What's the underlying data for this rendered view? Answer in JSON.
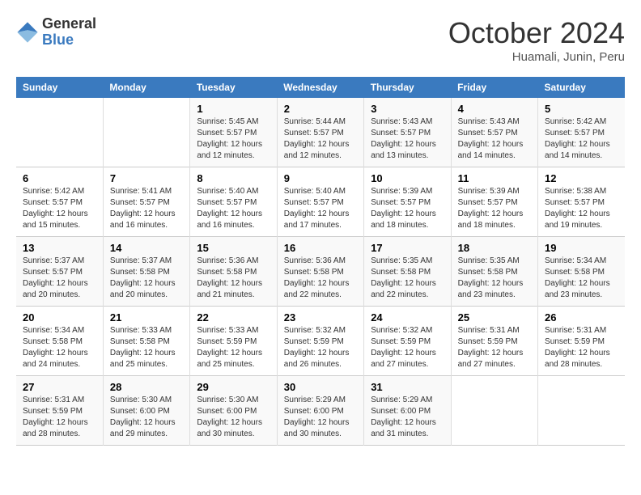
{
  "header": {
    "logo_line1": "General",
    "logo_line2": "Blue",
    "month": "October 2024",
    "location": "Huamali, Junin, Peru"
  },
  "weekdays": [
    "Sunday",
    "Monday",
    "Tuesday",
    "Wednesday",
    "Thursday",
    "Friday",
    "Saturday"
  ],
  "weeks": [
    [
      {
        "day": "",
        "info": ""
      },
      {
        "day": "",
        "info": ""
      },
      {
        "day": "1",
        "info": "Sunrise: 5:45 AM\nSunset: 5:57 PM\nDaylight: 12 hours and 12 minutes."
      },
      {
        "day": "2",
        "info": "Sunrise: 5:44 AM\nSunset: 5:57 PM\nDaylight: 12 hours and 12 minutes."
      },
      {
        "day": "3",
        "info": "Sunrise: 5:43 AM\nSunset: 5:57 PM\nDaylight: 12 hours and 13 minutes."
      },
      {
        "day": "4",
        "info": "Sunrise: 5:43 AM\nSunset: 5:57 PM\nDaylight: 12 hours and 14 minutes."
      },
      {
        "day": "5",
        "info": "Sunrise: 5:42 AM\nSunset: 5:57 PM\nDaylight: 12 hours and 14 minutes."
      }
    ],
    [
      {
        "day": "6",
        "info": "Sunrise: 5:42 AM\nSunset: 5:57 PM\nDaylight: 12 hours and 15 minutes."
      },
      {
        "day": "7",
        "info": "Sunrise: 5:41 AM\nSunset: 5:57 PM\nDaylight: 12 hours and 16 minutes."
      },
      {
        "day": "8",
        "info": "Sunrise: 5:40 AM\nSunset: 5:57 PM\nDaylight: 12 hours and 16 minutes."
      },
      {
        "day": "9",
        "info": "Sunrise: 5:40 AM\nSunset: 5:57 PM\nDaylight: 12 hours and 17 minutes."
      },
      {
        "day": "10",
        "info": "Sunrise: 5:39 AM\nSunset: 5:57 PM\nDaylight: 12 hours and 18 minutes."
      },
      {
        "day": "11",
        "info": "Sunrise: 5:39 AM\nSunset: 5:57 PM\nDaylight: 12 hours and 18 minutes."
      },
      {
        "day": "12",
        "info": "Sunrise: 5:38 AM\nSunset: 5:57 PM\nDaylight: 12 hours and 19 minutes."
      }
    ],
    [
      {
        "day": "13",
        "info": "Sunrise: 5:37 AM\nSunset: 5:57 PM\nDaylight: 12 hours and 20 minutes."
      },
      {
        "day": "14",
        "info": "Sunrise: 5:37 AM\nSunset: 5:58 PM\nDaylight: 12 hours and 20 minutes."
      },
      {
        "day": "15",
        "info": "Sunrise: 5:36 AM\nSunset: 5:58 PM\nDaylight: 12 hours and 21 minutes."
      },
      {
        "day": "16",
        "info": "Sunrise: 5:36 AM\nSunset: 5:58 PM\nDaylight: 12 hours and 22 minutes."
      },
      {
        "day": "17",
        "info": "Sunrise: 5:35 AM\nSunset: 5:58 PM\nDaylight: 12 hours and 22 minutes."
      },
      {
        "day": "18",
        "info": "Sunrise: 5:35 AM\nSunset: 5:58 PM\nDaylight: 12 hours and 23 minutes."
      },
      {
        "day": "19",
        "info": "Sunrise: 5:34 AM\nSunset: 5:58 PM\nDaylight: 12 hours and 23 minutes."
      }
    ],
    [
      {
        "day": "20",
        "info": "Sunrise: 5:34 AM\nSunset: 5:58 PM\nDaylight: 12 hours and 24 minutes."
      },
      {
        "day": "21",
        "info": "Sunrise: 5:33 AM\nSunset: 5:58 PM\nDaylight: 12 hours and 25 minutes."
      },
      {
        "day": "22",
        "info": "Sunrise: 5:33 AM\nSunset: 5:59 PM\nDaylight: 12 hours and 25 minutes."
      },
      {
        "day": "23",
        "info": "Sunrise: 5:32 AM\nSunset: 5:59 PM\nDaylight: 12 hours and 26 minutes."
      },
      {
        "day": "24",
        "info": "Sunrise: 5:32 AM\nSunset: 5:59 PM\nDaylight: 12 hours and 27 minutes."
      },
      {
        "day": "25",
        "info": "Sunrise: 5:31 AM\nSunset: 5:59 PM\nDaylight: 12 hours and 27 minutes."
      },
      {
        "day": "26",
        "info": "Sunrise: 5:31 AM\nSunset: 5:59 PM\nDaylight: 12 hours and 28 minutes."
      }
    ],
    [
      {
        "day": "27",
        "info": "Sunrise: 5:31 AM\nSunset: 5:59 PM\nDaylight: 12 hours and 28 minutes."
      },
      {
        "day": "28",
        "info": "Sunrise: 5:30 AM\nSunset: 6:00 PM\nDaylight: 12 hours and 29 minutes."
      },
      {
        "day": "29",
        "info": "Sunrise: 5:30 AM\nSunset: 6:00 PM\nDaylight: 12 hours and 30 minutes."
      },
      {
        "day": "30",
        "info": "Sunrise: 5:29 AM\nSunset: 6:00 PM\nDaylight: 12 hours and 30 minutes."
      },
      {
        "day": "31",
        "info": "Sunrise: 5:29 AM\nSunset: 6:00 PM\nDaylight: 12 hours and 31 minutes."
      },
      {
        "day": "",
        "info": ""
      },
      {
        "day": "",
        "info": ""
      }
    ]
  ]
}
